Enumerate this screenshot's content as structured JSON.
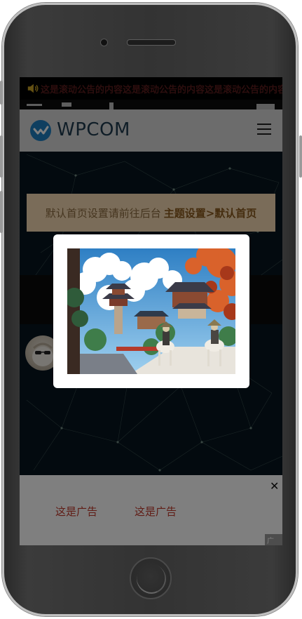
{
  "announcement": {
    "icon": "speaker-icon",
    "text": "这是滚动公告的内容这是滚动公告的内容这是滚动公告的内容"
  },
  "header": {
    "logo_icon": "wpcom-logo-icon",
    "logo_text": "WPCOM",
    "menu_icon": "hamburger-menu-icon"
  },
  "notice": {
    "text": "默认首页设置请前往后台",
    "link_text": "主题设置>默认首页"
  },
  "popup": {
    "image_icon": "anime-village-horsemen-image"
  },
  "ad_bar": {
    "links": [
      "这是广告",
      "这是广告"
    ],
    "close_label": "✕",
    "tag": "广告"
  },
  "colors": {
    "screen_bg": "#06151e",
    "header_bg": "#d9d9d9",
    "notice_bg": "#f4d9b2",
    "announce_text": "#5a1c1c",
    "ad_text": "#c0392b",
    "brand": "#1e7fc1"
  }
}
